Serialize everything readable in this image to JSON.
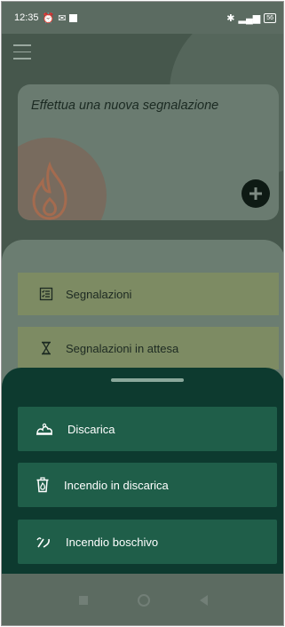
{
  "statusbar": {
    "time": "12:35",
    "battery": "56"
  },
  "home": {
    "card_title": "Effettua una nuova segnalazione",
    "menu": [
      {
        "label": "Segnalazioni",
        "icon": "checklist-icon"
      },
      {
        "label": "Segnalazioni in attesa",
        "icon": "hourglass-icon"
      }
    ]
  },
  "sheet": {
    "options": [
      {
        "label": "Discarica",
        "icon": "trash-pile-icon"
      },
      {
        "label": "Incendio in discarica",
        "icon": "trash-fire-icon"
      },
      {
        "label": "Incendio boschivo",
        "icon": "forest-fire-icon"
      }
    ]
  },
  "colors": {
    "sheet_bg": "#0d3a2f",
    "button_bg": "#1f5e49",
    "menu_bg": "#7d8b63"
  }
}
